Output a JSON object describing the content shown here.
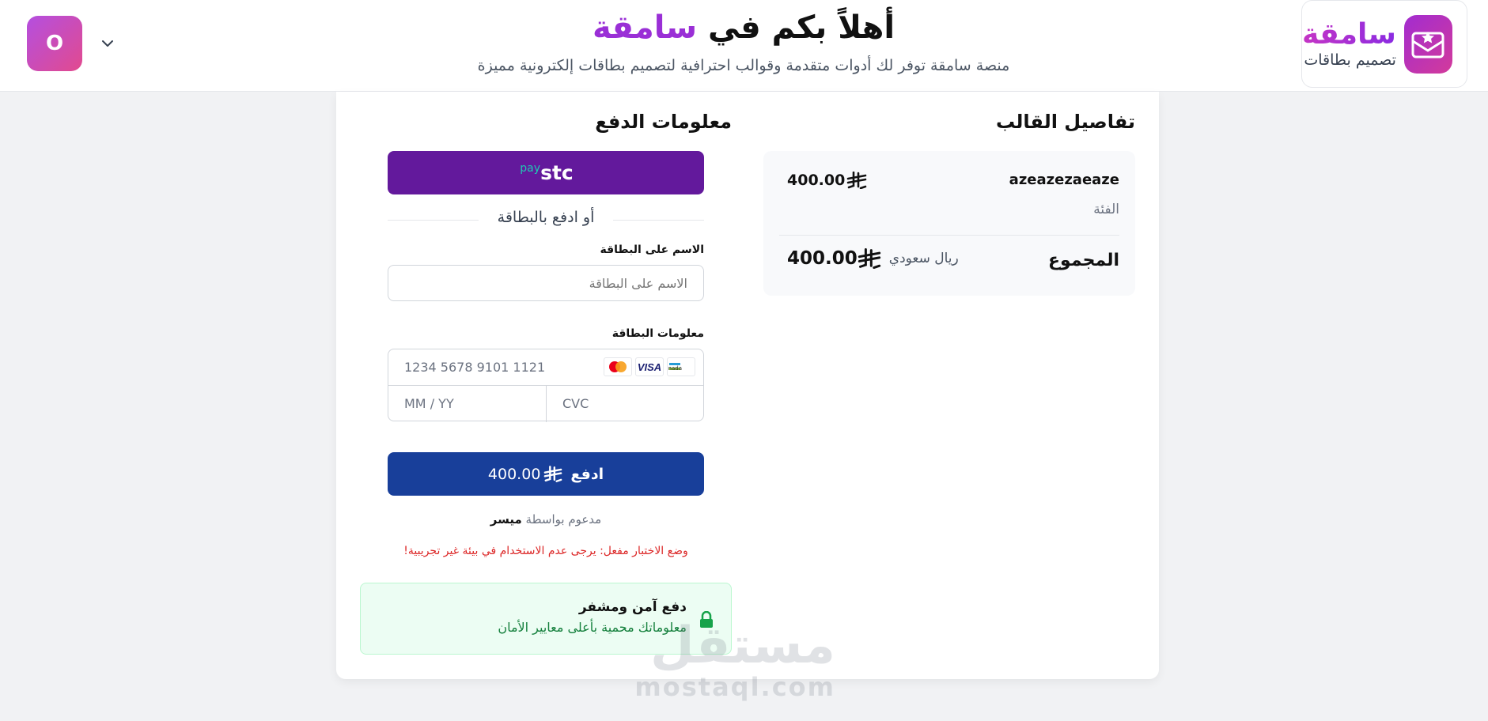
{
  "header": {
    "brand_name": "سامقة",
    "brand_sub": "تصميم بطاقات",
    "welcome_prefix": "أهلاً بكم في ",
    "welcome_accent": "سامقة",
    "welcome_sub": "منصة سامقة توفر لك أدوات متقدمة وقوالب احترافية لتصميم بطاقات إلكترونية مميزة",
    "avatar_letter": "O"
  },
  "details": {
    "title": "تفاصيل القالب",
    "template_name": "azeazezaeaze",
    "template_price": "400.00",
    "category_label": "الفئة",
    "total_label": "المجموع",
    "total_value": "400.00",
    "currency_text": "ريال سعودي"
  },
  "payment": {
    "title": "معلومات الدفع",
    "stc_text": "stc",
    "stc_pay": "pay",
    "or_text": "أو ادفع بالبطاقة",
    "name_label": "الاسم على البطاقة",
    "name_placeholder": "الاسم على البطاقة",
    "card_label": "معلومات البطاقة",
    "card_number_placeholder": "1234 5678 9101 1121",
    "expiry_placeholder": "MM / YY",
    "cvc_placeholder": "CVC",
    "card_brands": [
      "mada",
      "VISA",
      "mastercard"
    ],
    "pay_label": "ادفع",
    "pay_amount": "400.00",
    "powered_prefix": "مدعوم بواسطة ",
    "powered_brand": "ميسر",
    "test_warning": "وضع الاختبار مفعل: يرجى عدم الاستخدام في بيئة غير تجريبية!",
    "secure_title": "دفع آمن ومشفر",
    "secure_desc": "معلوماتك محمية بأعلى معايير الأمان"
  },
  "watermark": {
    "main": "مستقل",
    "sub": "mostaql.com"
  },
  "colors": {
    "brand_purple": "#9a2fd6",
    "stc_purple": "#63199c",
    "pay_blue": "#183f9a",
    "warning_red": "#dc2626",
    "secure_green": "#15803d"
  }
}
